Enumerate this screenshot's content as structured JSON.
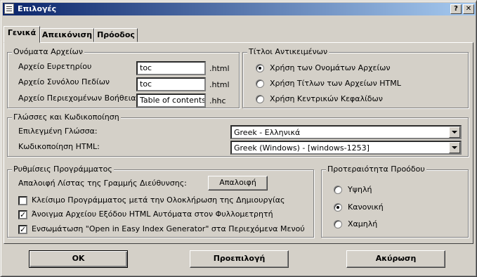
{
  "window": {
    "title": "Επιλογές",
    "help_btn": "?",
    "close_btn": "✕"
  },
  "tabs": [
    "Γενικά",
    "Απεικόνιση",
    "Πρόοδος"
  ],
  "file_names": {
    "legend": "Ονόματα Αρχείων",
    "rows": [
      {
        "label": "Αρχείο Ευρετηρίου",
        "value": "toc",
        "ext": ".html"
      },
      {
        "label": "Αρχείο Συνόλου Πεδίων",
        "value": "toc",
        "ext": ".html"
      },
      {
        "label": "Αρχείο Περιεχομένων Βοήθειας",
        "value": "Table of contents",
        "ext": ".hhc"
      }
    ]
  },
  "object_titles": {
    "legend": "Τίτλοι Αντικειμένων",
    "options": [
      "Χρήση των Ονομάτων Αρχείων",
      "Χρήση Τίτλων των Αρχείων HTML",
      "Χρήση Κεντρικών Κεφαλίδων"
    ],
    "selected": 0
  },
  "languages": {
    "legend": "Γλώσσες και Κωδικοποίηση",
    "lang_label": "Επιλεγμένη Γλώσσα:",
    "lang_value": "Greek - Ελληνικά",
    "enc_label": "Κωδικοποίηση HTML:",
    "enc_value": "Greek (Windows) - [windows-1253]"
  },
  "program": {
    "legend": "Ρυθμίσεις Προγράμματος",
    "clear_label": "Απαλοιφή Λίστας της Γραμμής Διεύθυνσης:",
    "clear_btn": "Απαλοιφή",
    "checks": [
      {
        "label": "Κλείσιμο Προγράμματος μετά την Ολοκλήρωση της Δημιουργίας",
        "checked": false
      },
      {
        "label": "Άνοιγμα Αρχείου Εξόδου HTML Αυτόματα στον Φυλλομετρητή",
        "checked": true
      },
      {
        "label": "Ενσωμάτωση \"Open in Easy Index Generator\" στα Περιεχόμενα Μενού",
        "checked": true
      }
    ]
  },
  "priority": {
    "legend": "Προτεραιότητα Προόδου",
    "options": [
      "Υψηλή",
      "Κανονική",
      "Χαμηλή"
    ],
    "selected": 1
  },
  "buttons": {
    "ok": "OK",
    "default": "Προεπιλογή",
    "cancel": "Ακύρωση"
  }
}
